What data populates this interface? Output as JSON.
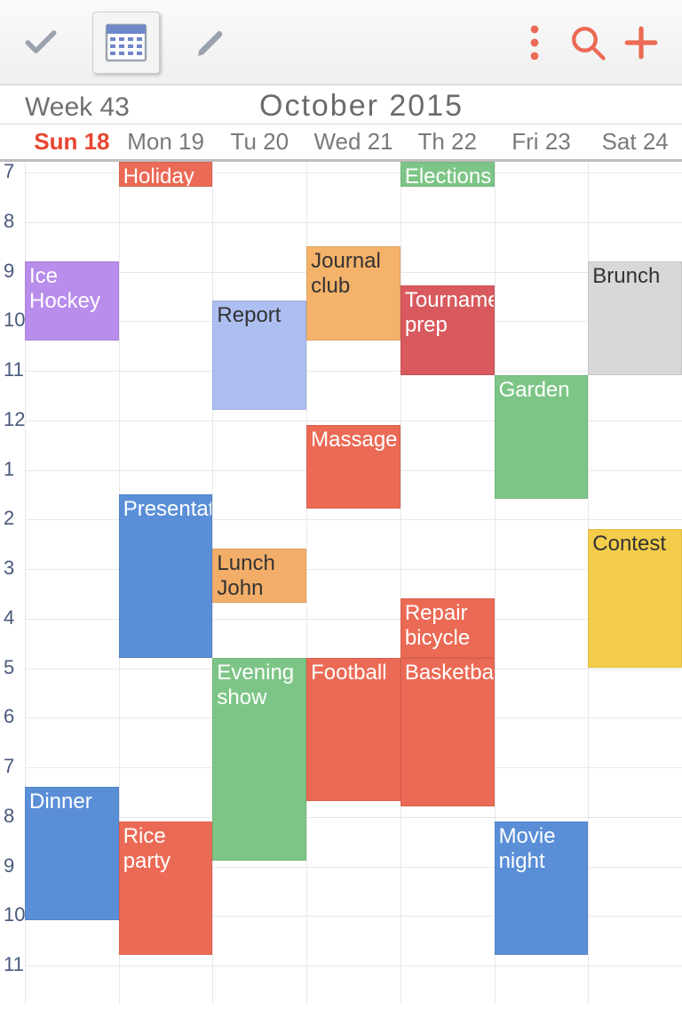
{
  "toolbar": {
    "icons": [
      "checkmark",
      "calendar-view",
      "pencil",
      "more",
      "search",
      "plus"
    ]
  },
  "header": {
    "week_label": "Week 43",
    "month_label": "October   2015"
  },
  "days": [
    {
      "label": "Sun 18",
      "today": true
    },
    {
      "label": "Mon 19",
      "today": false
    },
    {
      "label": "Tu 20",
      "today": false
    },
    {
      "label": "Wed 21",
      "today": false
    },
    {
      "label": "Th 22",
      "today": false
    },
    {
      "label": "Fri 23",
      "today": false
    },
    {
      "label": "Sat 24",
      "today": false
    }
  ],
  "hours": [
    "7",
    "8",
    "9",
    "10",
    "11",
    "12",
    "1",
    "2",
    "3",
    "4",
    "5",
    "6",
    "7",
    "8",
    "9",
    "10",
    "11"
  ],
  "events": [
    {
      "title": "Holiday",
      "day": 1,
      "start": 7,
      "end": 7.5,
      "color": "c-red",
      "txt": "white"
    },
    {
      "title": "Elections",
      "day": 4,
      "start": 7,
      "end": 7.5,
      "color": "c-green",
      "txt": "white"
    },
    {
      "title": "Ice Hockey",
      "day": 0,
      "start": 9,
      "end": 10.6,
      "color": "c-purple",
      "txt": "white"
    },
    {
      "title": "Journal club",
      "day": 3,
      "start": 8.7,
      "end": 10.6,
      "color": "c-orange",
      "txt": "dark"
    },
    {
      "title": "Brunch",
      "day": 6,
      "start": 9,
      "end": 11.3,
      "color": "c-grey",
      "txt": "dark"
    },
    {
      "title": "Report",
      "day": 2,
      "start": 9.8,
      "end": 12,
      "color": "c-lblue",
      "txt": "dark"
    },
    {
      "title": "Tournament prep",
      "day": 4,
      "start": 9.5,
      "end": 11.3,
      "color": "c-dkred",
      "txt": "white"
    },
    {
      "title": "Garden",
      "day": 5,
      "start": 11.3,
      "end": 13.8,
      "color": "c-green",
      "txt": "white"
    },
    {
      "title": "Massage",
      "day": 3,
      "start": 12.3,
      "end": 14,
      "color": "c-red",
      "txt": "white"
    },
    {
      "title": "Presentation",
      "day": 1,
      "start": 13.7,
      "end": 17,
      "color": "c-blue",
      "txt": "white"
    },
    {
      "title": "Lunch John",
      "day": 2,
      "start": 14.8,
      "end": 15.9,
      "color": "c-orange2",
      "txt": "dark"
    },
    {
      "title": "Contest",
      "day": 6,
      "start": 14.4,
      "end": 17.2,
      "color": "c-yellow",
      "txt": "dark"
    },
    {
      "title": "Repair bicycle",
      "day": 4,
      "start": 15.8,
      "end": 17,
      "color": "c-red",
      "txt": "white"
    },
    {
      "title": "Football",
      "day": 3,
      "start": 17,
      "end": 19.9,
      "color": "c-red",
      "txt": "white"
    },
    {
      "title": "Basketball",
      "day": 4,
      "start": 17,
      "end": 20,
      "color": "c-red",
      "txt": "white"
    },
    {
      "title": "Evening show",
      "day": 2,
      "start": 17,
      "end": 21.1,
      "color": "c-green",
      "txt": "white"
    },
    {
      "title": "Dinner",
      "day": 0,
      "start": 19.6,
      "end": 22.3,
      "color": "c-blue",
      "txt": "white"
    },
    {
      "title": "Rice party",
      "day": 1,
      "start": 20.3,
      "end": 23,
      "color": "c-red",
      "txt": "white"
    },
    {
      "title": "Movie night",
      "day": 5,
      "start": 20.3,
      "end": 23,
      "color": "c-blue",
      "txt": "white"
    }
  ],
  "colors": {
    "accent": "#e8452f"
  }
}
